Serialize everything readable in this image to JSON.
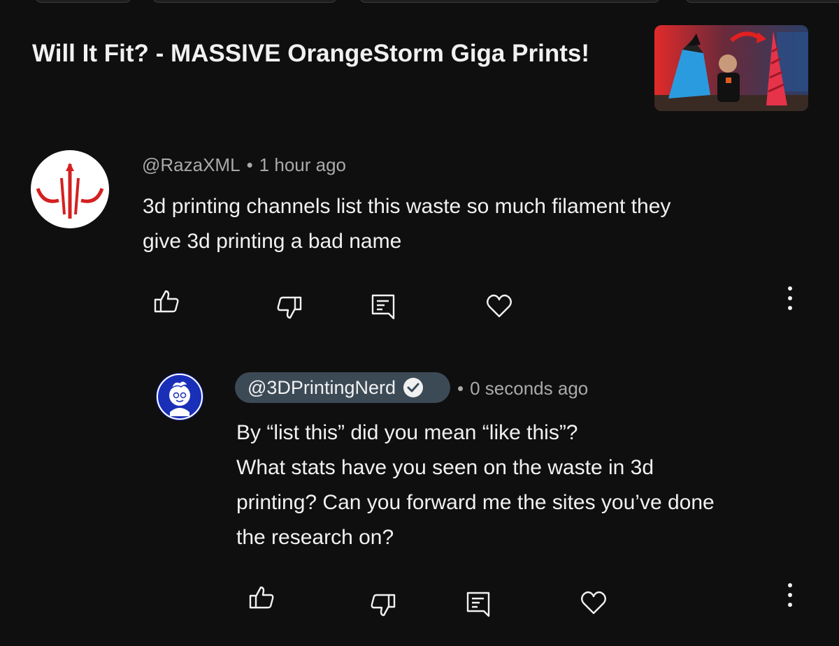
{
  "video": {
    "title": "Will It Fit? - MASSIVE OrangeStorm Giga Prints!"
  },
  "comments": [
    {
      "handle": "@RazaXML",
      "time": "1 hour ago",
      "text_line1": "3d printing channels list this waste so much filament they",
      "text_line2": "give 3d printing a bad name"
    }
  ],
  "reply": {
    "handle": "@3DPrintingNerd",
    "verified": true,
    "time": "0 seconds ago",
    "lines": [
      "By “list this” did you mean “like this”?",
      "What stats have you seen on the waste in 3d",
      "printing? Can you forward me the sites you’ve done",
      "the research on?"
    ]
  },
  "icons": {
    "like": "thumbs-up-icon",
    "dislike": "thumbs-down-icon",
    "reply": "reply-icon",
    "heart": "heart-icon",
    "more": "more-vertical-icon",
    "verified": "verified-check-icon"
  },
  "colors": {
    "background": "#0f0f0f",
    "text": "#f1f1f1",
    "meta": "#aaaaaa",
    "handle_chip": "#3c4a56"
  },
  "separator": "•"
}
